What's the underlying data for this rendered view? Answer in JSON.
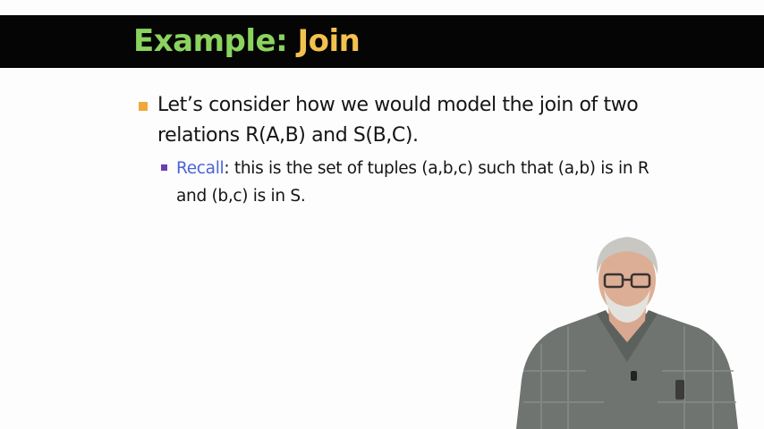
{
  "slide": {
    "title_part1": "Example: ",
    "title_part2": "Join",
    "bullet1_text": "Let’s consider how we would model the join of two relations R(A,B) and S(B,C).",
    "bullet2_highlight": "Recall",
    "bullet2_text": ": this is the set of tuples (a,b,c) such that (a,b) is in R and (b,c) is in S.",
    "colors": {
      "title_bar": "#050505",
      "title_green": "#8bd35f",
      "title_yellow": "#f2c14e",
      "bullet_orange": "#f0a83b",
      "bullet_purple": "#6a3fb0",
      "highlight_blue": "#4a64d6"
    }
  },
  "presenter": {
    "icon": "presenter-video"
  }
}
